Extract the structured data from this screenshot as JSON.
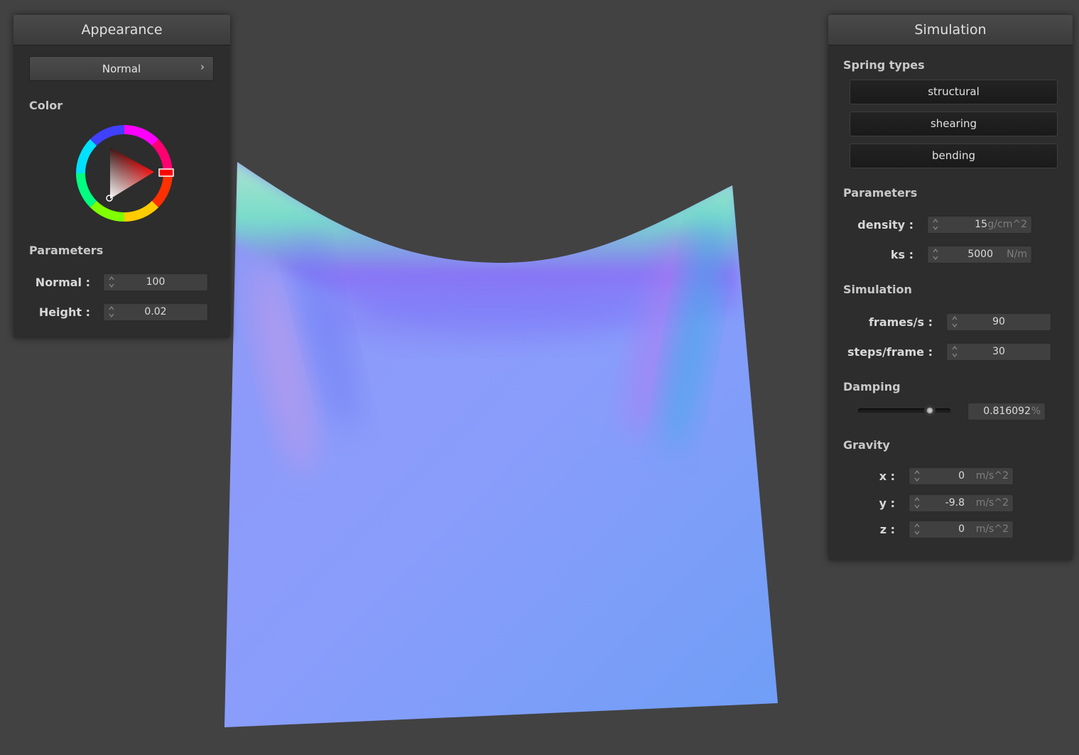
{
  "appearance": {
    "title": "Appearance",
    "shader": {
      "selected": "Normal"
    },
    "color_label": "Color",
    "parameters_label": "Parameters",
    "normal": {
      "label": "Normal :",
      "value": "100"
    },
    "height": {
      "label": "Height :",
      "value": "0.02"
    }
  },
  "simulation": {
    "title": "Simulation",
    "spring_types_label": "Spring types",
    "springs": [
      "structural",
      "shearing",
      "bending"
    ],
    "parameters_label": "Parameters",
    "density": {
      "label": "density :",
      "value": "15",
      "unit": "g/cm^2"
    },
    "ks": {
      "label": "ks :",
      "value": "5000",
      "unit": "N/m"
    },
    "sim_label": "Simulation",
    "fps": {
      "label": "frames/s :",
      "value": "90"
    },
    "steps": {
      "label": "steps/frame :",
      "value": "30"
    },
    "damping_label": "Damping",
    "damping": {
      "value": "0.816092",
      "unit": "%",
      "slider_fraction": 0.816
    },
    "gravity_label": "Gravity",
    "gravity": [
      {
        "label": "x :",
        "value": "0",
        "unit": "m/s^2"
      },
      {
        "label": "y :",
        "value": "-9.8",
        "unit": "m/s^2"
      },
      {
        "label": "z :",
        "value": "0",
        "unit": "m/s^2"
      }
    ]
  },
  "colors": {
    "background": "#424242",
    "panel": "#2d2d2d",
    "selected_color": "#ff0000",
    "cloth_base": "#7f95f8"
  }
}
